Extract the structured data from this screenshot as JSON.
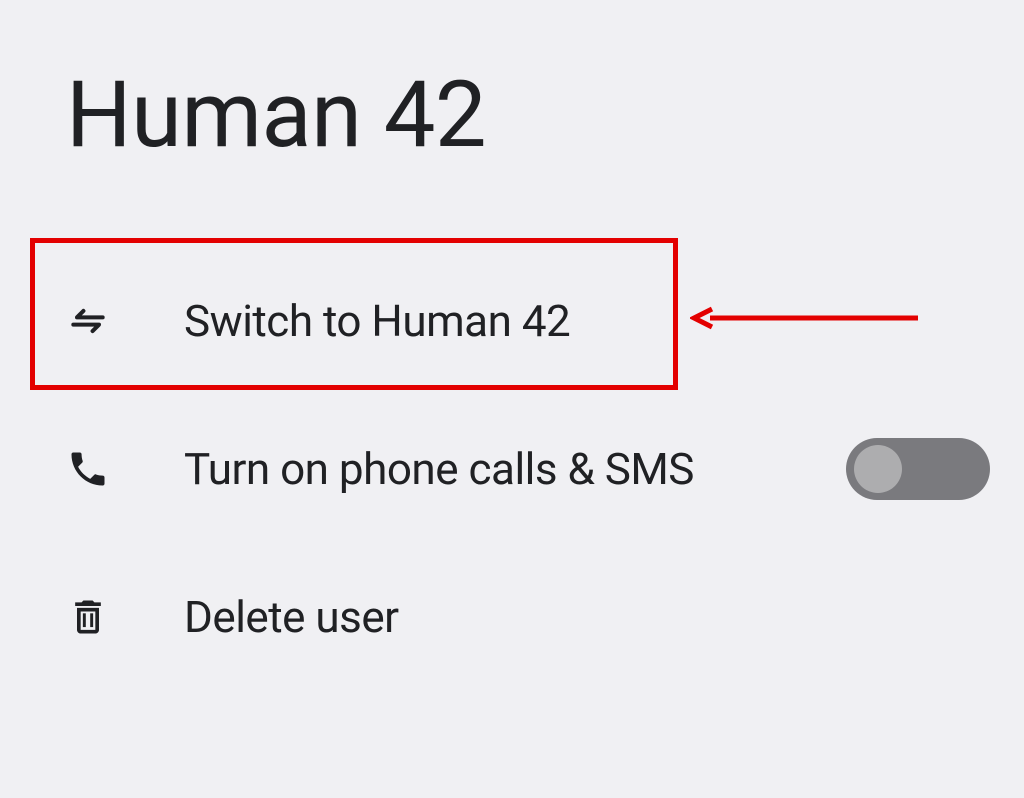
{
  "title": "Human 42",
  "options": {
    "switch_user": {
      "label": "Switch to Human 42"
    },
    "phone_sms": {
      "label": "Turn on phone calls & SMS",
      "toggled": false
    },
    "delete_user": {
      "label": "Delete user"
    }
  },
  "annotation": {
    "highlighted_option": "switch_user"
  }
}
